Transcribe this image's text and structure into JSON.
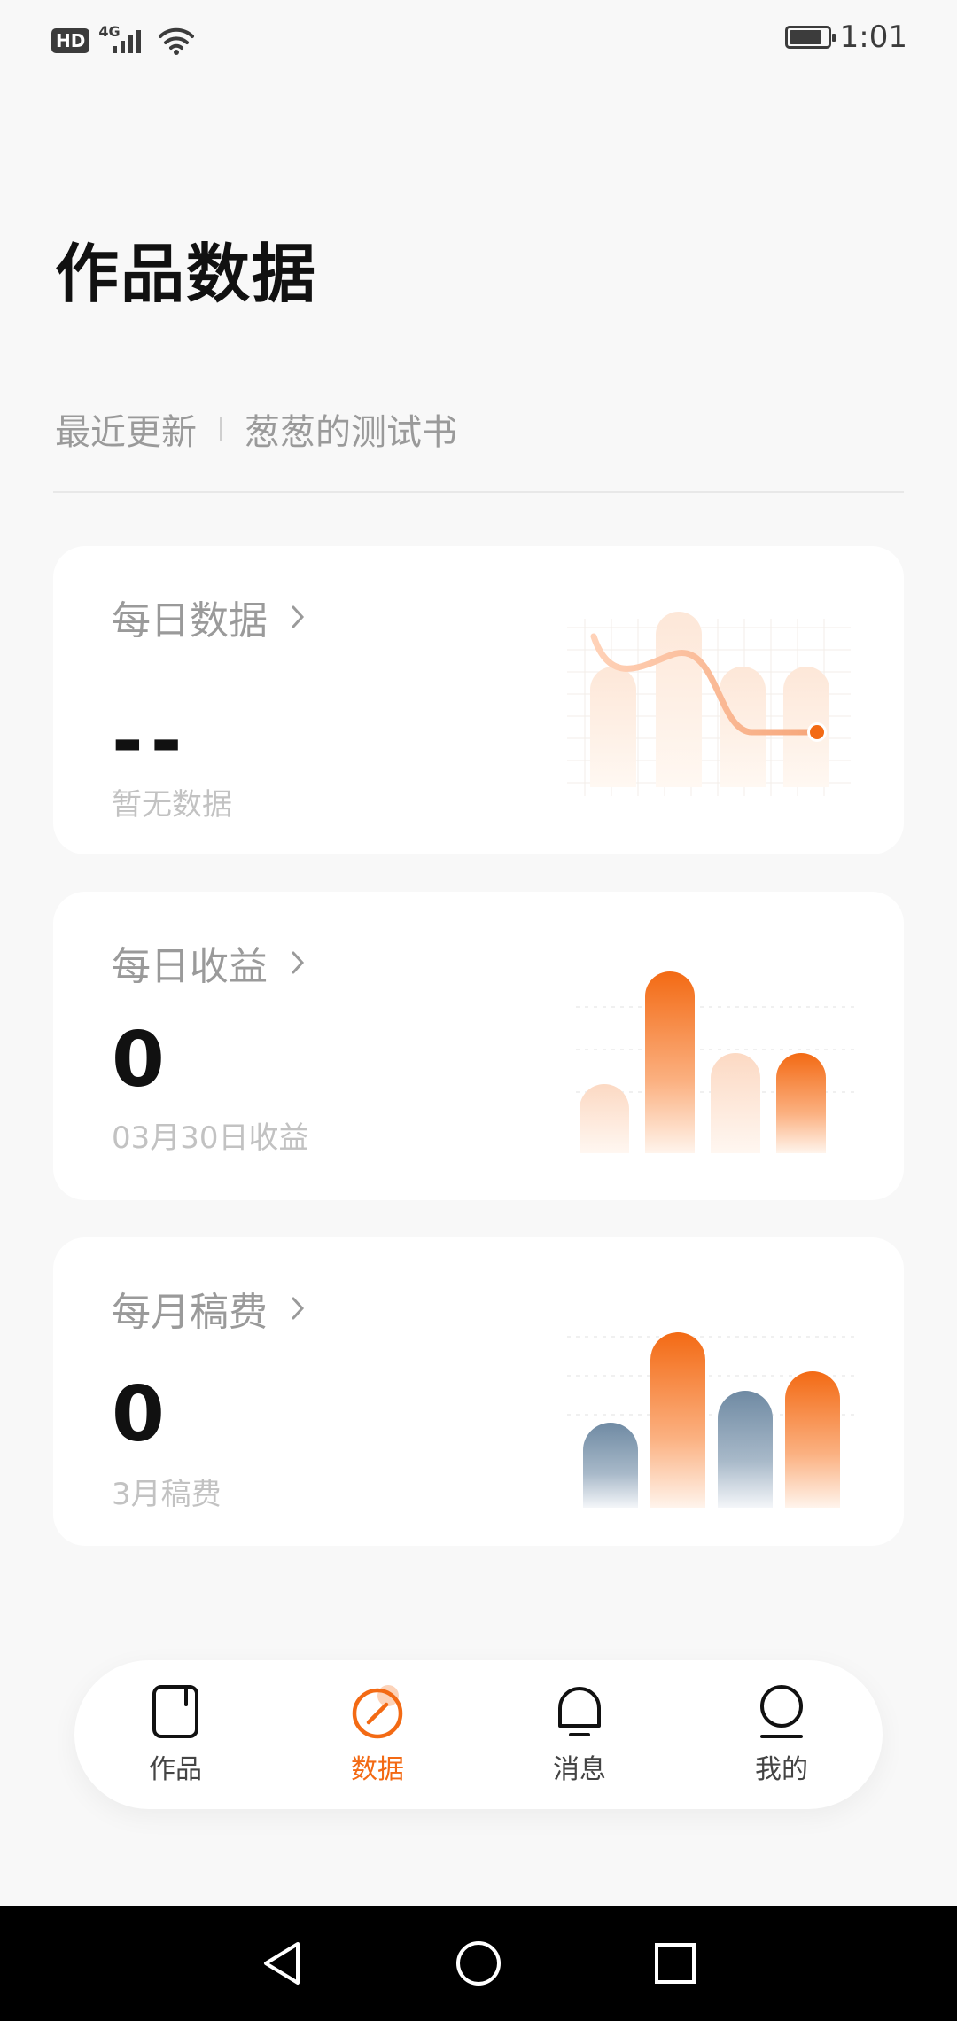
{
  "status_bar": {
    "hd_badge": "HD",
    "network": "4G",
    "time": "1:01"
  },
  "page": {
    "title": "作品数据"
  },
  "recent_update": {
    "label": "最近更新",
    "book": "葱葱的测试书"
  },
  "cards": [
    {
      "title": "每日数据",
      "value": "--",
      "subtitle": "暂无数据"
    },
    {
      "title": "每日收益",
      "value": "0",
      "subtitle": "03月30日收益"
    },
    {
      "title": "每月稿费",
      "value": "0",
      "subtitle": "3月稿费"
    }
  ],
  "bottom_nav": {
    "items": [
      {
        "label": "作品",
        "icon": "book-icon",
        "active": false
      },
      {
        "label": "数据",
        "icon": "data-compass-icon",
        "active": true
      },
      {
        "label": "消息",
        "icon": "bell-icon",
        "active": false
      },
      {
        "label": "我的",
        "icon": "profile-icon",
        "active": false
      }
    ]
  },
  "system_nav": {
    "buttons": [
      "back-icon",
      "home-icon",
      "recents-icon"
    ]
  },
  "colors": {
    "accent": "#f36a14",
    "muted_blue": "#6f8aa3",
    "text_dark": "#111111",
    "text_gray": "#9a9a9a"
  }
}
